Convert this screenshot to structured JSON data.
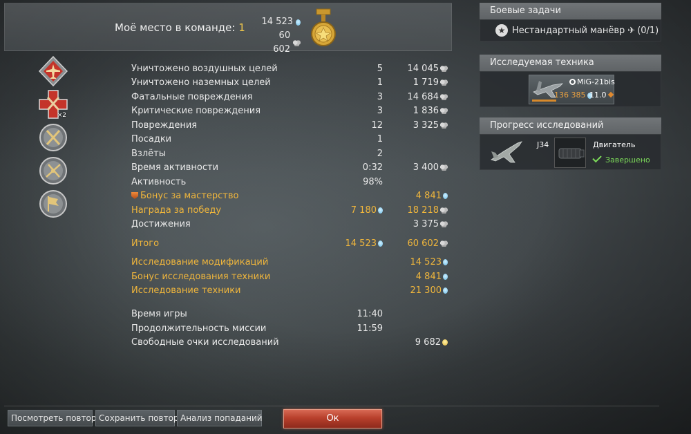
{
  "header": {
    "place_label": "Моё место в команде:",
    "place_value": "1",
    "total_rp": "14 523",
    "total_sl": "60 602"
  },
  "awards": [
    {
      "name": "award-aircraft-icon",
      "badge": ""
    },
    {
      "name": "award-multi-kill-icon",
      "badge": "×2"
    },
    {
      "name": "award-crossed-swords-icon",
      "badge": ""
    },
    {
      "name": "award-crossed-rockets-icon",
      "badge": ""
    },
    {
      "name": "award-flag-icon",
      "badge": ""
    }
  ],
  "stats": {
    "rows": [
      {
        "label": "Уничтожено воздушных целей",
        "count": "5",
        "reward": "14 045",
        "reward_icon": "sl",
        "style": "normal"
      },
      {
        "label": "Уничтожено наземных целей",
        "count": "1",
        "reward": "1 719",
        "reward_icon": "sl",
        "style": "normal"
      },
      {
        "label": "Фатальные повреждения",
        "count": "3",
        "reward": "14 684",
        "reward_icon": "sl",
        "style": "normal"
      },
      {
        "label": "Критические повреждения",
        "count": "3",
        "reward": "1 836",
        "reward_icon": "sl",
        "style": "normal"
      },
      {
        "label": "Повреждения",
        "count": "12",
        "reward": "3 325",
        "reward_icon": "sl",
        "style": "normal"
      },
      {
        "label": "Посадки",
        "count": "1",
        "reward": "",
        "reward_icon": "",
        "style": "normal"
      },
      {
        "label": "Взлёты",
        "count": "2",
        "reward": "",
        "reward_icon": "",
        "style": "normal"
      },
      {
        "label": "Время активности",
        "count": "0:32",
        "reward": "3 400",
        "reward_icon": "sl",
        "style": "normal"
      },
      {
        "label": "Активность",
        "count": "98%",
        "reward": "",
        "reward_icon": "",
        "style": "normal"
      },
      {
        "label": "Бонус за мастерство",
        "count": "",
        "reward": "4 841",
        "reward_icon": "rp",
        "style": "gold",
        "prefix_icon": "mastery-icon"
      },
      {
        "label": "Награда за победу",
        "count": "7 180",
        "count_icon": "rp",
        "reward": "18 218",
        "reward_icon": "sl",
        "style": "gold"
      },
      {
        "label": "Достижения",
        "count": "",
        "reward": "3 375",
        "reward_icon": "sl",
        "style": "normal"
      },
      {
        "label": "Итого",
        "count": "14 523",
        "count_icon": "rp",
        "reward": "60 602",
        "reward_icon": "sl",
        "style": "gold"
      },
      {
        "label": "Исследование модификаций",
        "count": "",
        "reward": "14 523",
        "reward_icon": "rp",
        "style": "gold"
      },
      {
        "label": "Бонус исследования техники",
        "count": "",
        "reward": "4 841",
        "reward_icon": "rp",
        "style": "gold"
      },
      {
        "label": "Исследование техники",
        "count": "",
        "reward": "21 300",
        "reward_icon": "rp",
        "style": "gold"
      },
      {
        "label": "Время игры",
        "count": "11:40",
        "reward": "",
        "reward_icon": "",
        "style": "normal"
      },
      {
        "label": "Продолжительность миссии",
        "count": "11:59",
        "reward": "",
        "reward_icon": "",
        "style": "normal"
      },
      {
        "label": "Свободные очки исследований",
        "count": "",
        "reward": "9 682",
        "reward_icon": "frp",
        "style": "normal"
      }
    ]
  },
  "tasks": {
    "title": "Боевые задачи",
    "item_label": "Нестандартный манёвр",
    "item_progress": "(0/1)"
  },
  "research_vehicle": {
    "title": "Исследуемая техника",
    "name": "MiG-21bis",
    "rp": "136 385",
    "br": "11.0",
    "progress": 0.3
  },
  "research_progress": {
    "title": "Прогресс исследований",
    "vehicle": "J34",
    "module": "Двигатель",
    "status": "Завершено"
  },
  "buttons": {
    "replay": "Посмотреть повтор",
    "save_replay": "Сохранить повтор",
    "hit_analysis": "Анализ попаданий",
    "ok": "Ок"
  },
  "colors": {
    "gold": "#f0b63c",
    "rp": "#6fbfe8",
    "ok_button": "#b8402c",
    "complete": "#7ddc5a"
  }
}
